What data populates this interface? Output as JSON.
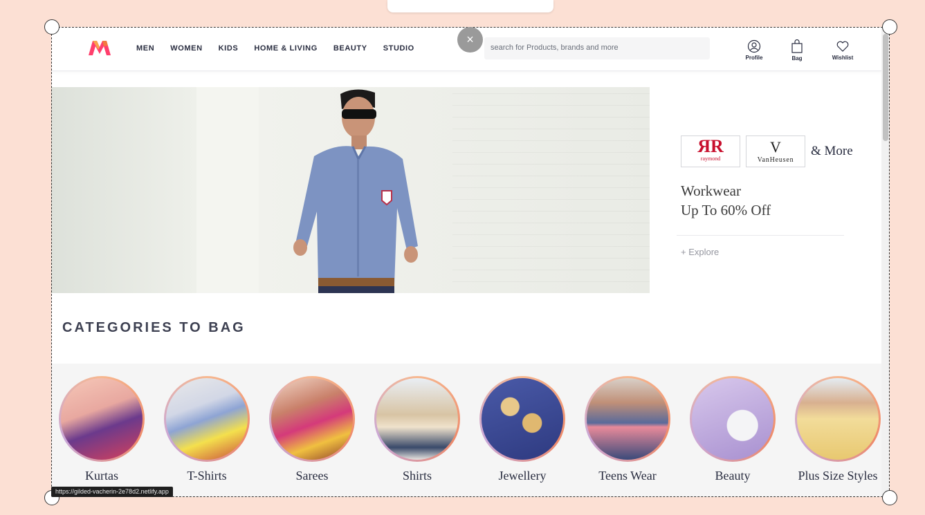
{
  "header": {
    "nav": [
      "MEN",
      "WOMEN",
      "KIDS",
      "HOME & LIVING",
      "BEAUTY",
      "STUDIO"
    ],
    "search_placeholder": "search for Products, brands and more",
    "profile_label": "Profile",
    "bag_label": "Bag",
    "wishlist_label": "Wishlist",
    "close_symbol": "×"
  },
  "promo": {
    "brand1": "raymond",
    "brand2": "VanHeusen",
    "more": "& More",
    "headline_line1": "Workwear",
    "headline_line2": "Up To 60% Off",
    "explore": "+ Explore"
  },
  "categories": {
    "title": "CATEGORIES TO BAG",
    "items": [
      "Kurtas",
      "T-Shirts",
      "Sarees",
      "Shirts",
      "Jewellery",
      "Teens Wear",
      "Beauty",
      "Plus Size Styles"
    ]
  },
  "status_url": "https://gilded-vacherin-2e78d2.netlify.app",
  "colors": {
    "background": "#fce0d4",
    "logo_pink": "#ff3f6c",
    "logo_orange": "#f8a34b",
    "text_dark": "#282c3f"
  }
}
